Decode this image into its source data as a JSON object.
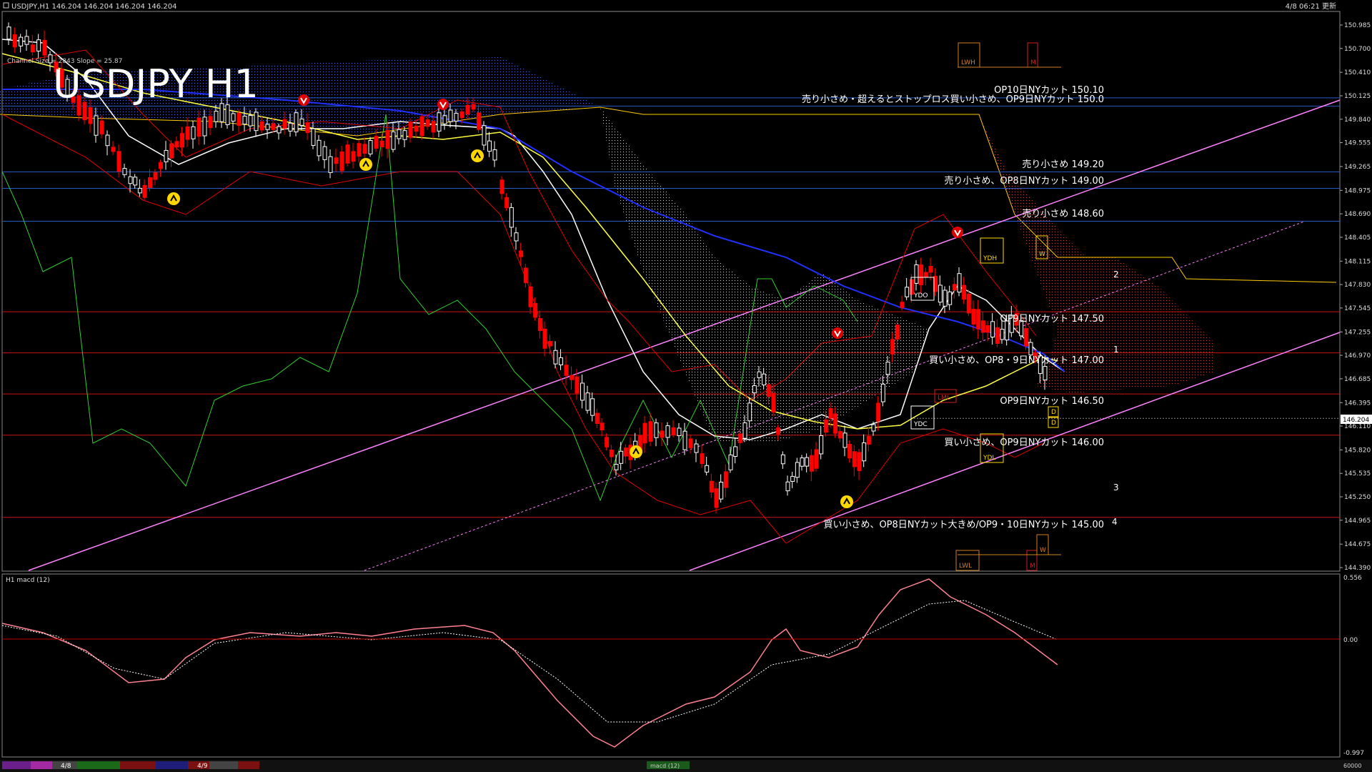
{
  "window": {
    "title": "USDJPY,H1 146.204 146.204 146.204 146.204",
    "update_time": "4/8 06:21 更新",
    "chart_name": "USDJPY H1",
    "info_line": "Channel Size = 2843  Slope = 25.87",
    "subwindow_title": "H1  macd (12)",
    "current_price": "146.204"
  },
  "price_axis": {
    "labels": [
      "150.985",
      "150.700",
      "150.410",
      "150.125",
      "149.840",
      "149.555",
      "149.265",
      "148.975",
      "148.690",
      "148.405",
      "148.115",
      "147.830",
      "147.545",
      "147.255",
      "146.970",
      "146.685",
      "146.395",
      "146.110",
      "145.820",
      "145.535",
      "145.250",
      "144.965",
      "144.675",
      "144.390"
    ]
  },
  "macd_axis": {
    "labels": [
      "0.556",
      "0.00",
      "-0.997"
    ]
  },
  "annotations": [
    "OP10日NYカット 150.10",
    "売り小さめ・超えるとストップロス買い小さめ、OP9日NYカット 150.0",
    "売り小さめ 149.20",
    "売り小さめ、OP8日NYカット 149.00",
    "売り小さめ 148.60",
    "OP9日NYカット 147.50",
    "買い小さめ、OP8・9日NYカット 147.00",
    "OP9日NYカット 146.50",
    "買い小さめ、OP9日NYカット 146.00",
    "買い小さめ、OP8日NYカット大きめ/OP9・10日NYカット 145.00"
  ],
  "boxes": {
    "lwh": "LWH",
    "m_top": "M",
    "ydh": "YDH",
    "w_top": "W",
    "ydo": "YDO",
    "ydc": "YDC",
    "ydl": "YDL",
    "lml": "LML",
    "lwl": "LWL",
    "m_bot": "M",
    "w_bot": "W",
    "d1": "D",
    "d2": "D"
  },
  "wave_labels": [
    "1",
    "2",
    "3",
    "4"
  ],
  "bottom_bar": {
    "date1": "4/8",
    "date2": "4/9",
    "tab": "macd (12)",
    "right_label": "60000"
  },
  "colors": {
    "background": "#000000",
    "bull_candle": "#ffffff",
    "bear_candle": "#ff0000",
    "channel": "#ff80ff",
    "kumo": "#4060ff",
    "cloud_upper": "#ffcc00",
    "ma_fast": "#ffffff",
    "ma_slow": "#ffff40",
    "ma_long": "#2030ff",
    "bollinger": "#e00000",
    "chikou": "#30d030",
    "macd_up": "#60ff60",
    "macd_down": "#ff8090"
  }
}
